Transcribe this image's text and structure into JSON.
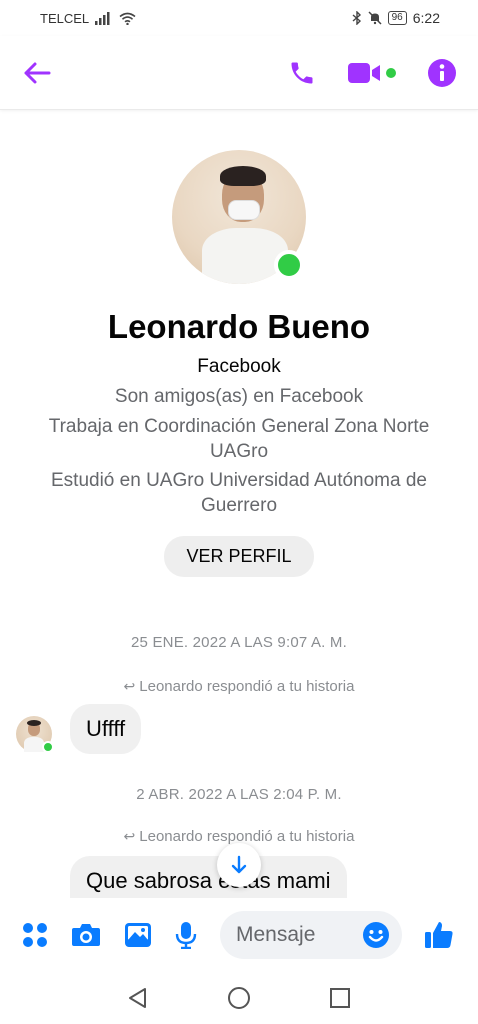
{
  "status_bar": {
    "carrier": "TELCEL",
    "battery": "96",
    "time": "6:22"
  },
  "header": {
    "back_icon": "arrow-left-icon",
    "call_icon": "phone-icon",
    "video_icon": "video-camera-icon",
    "info_icon": "info-icon"
  },
  "profile": {
    "name": "Leonardo Bueno",
    "platform": "Facebook",
    "friends": "Son amigos(as) en Facebook",
    "work": "Trabaja en Coordinación General Zona Norte UAGro",
    "study": "Estudió en UAGro Universidad Autónoma de Guerrero",
    "view_profile_label": "VER PERFIL"
  },
  "messages": [
    {
      "timestamp": "25 ENE. 2022 A LAS 9:07 A. M.",
      "reply_note": "Leonardo respondió a tu historia",
      "text": "Uffff"
    },
    {
      "timestamp": "2 ABR. 2022 A LAS 2:04 P. M.",
      "reply_note": "Leonardo respondió a tu historia",
      "text": "Que sabrosa estás mami"
    }
  ],
  "composer": {
    "placeholder": "Mensaje"
  },
  "colors": {
    "accent": "#a033ff",
    "messenger_blue": "#0a7cff",
    "online": "#31cc46"
  }
}
